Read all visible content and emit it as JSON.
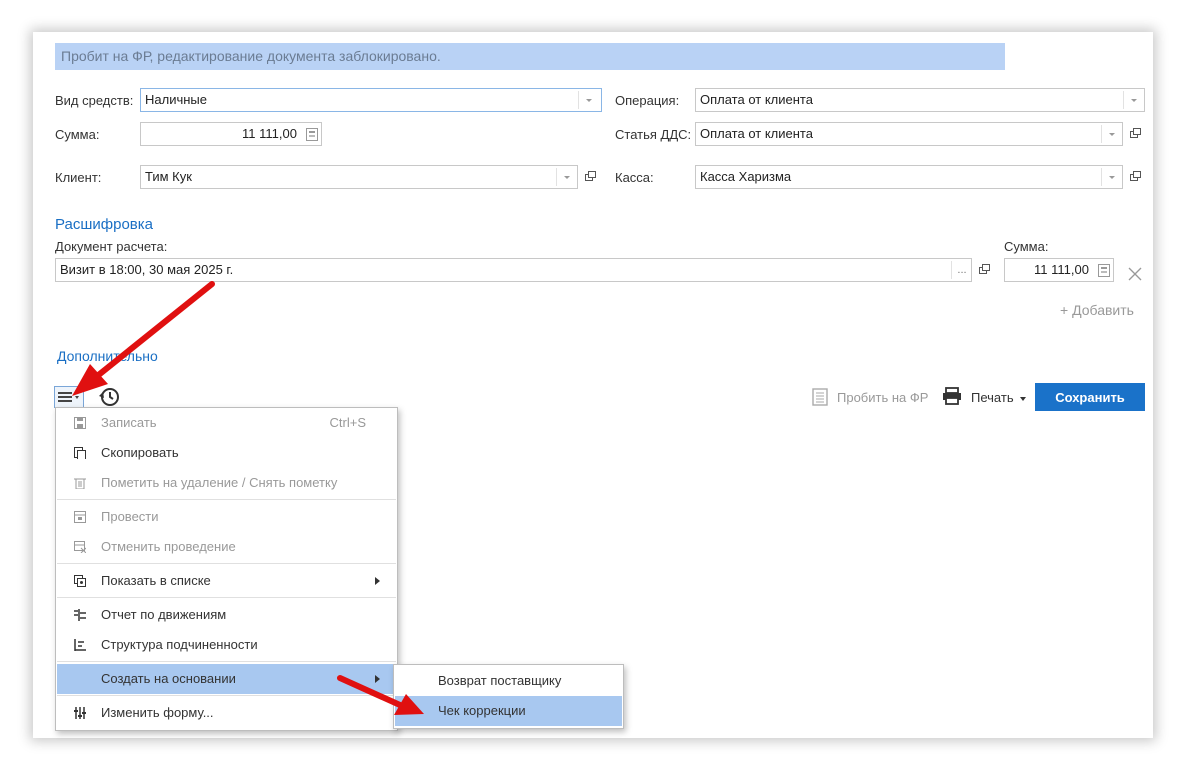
{
  "banner": "Пробит на ФР, редактирование документа заблокировано.",
  "form": {
    "vid_label": "Вид средств:",
    "vid_value": "Наличные",
    "summa_label": "Сумма:",
    "summa_value": "11 111,00",
    "client_label": "Клиент:",
    "client_value": "Тим Кук",
    "operation_label": "Операция:",
    "operation_value": "Оплата от клиента",
    "dds_label": "Статья ДДС:",
    "dds_value": "Оплата от клиента",
    "kassa_label": "Касса:",
    "kassa_value": "Касса Харизма"
  },
  "breakdown": {
    "title": "Расшифровка",
    "doc_label": "Документ расчета:",
    "doc_value": "Визит в 18:00, 30 мая 2025 г.",
    "sum_label": "Сумма:",
    "sum_value": "11 111,00",
    "add_label": "+ Добавить",
    "more_picker": "..."
  },
  "extra_link": "Дополнительно",
  "toolbar": {
    "fr_label": "Пробить на ФР",
    "print_label": "Печать",
    "save_label": "Сохранить"
  },
  "menu": {
    "items": [
      {
        "label": "Записать",
        "shortcut": "Ctrl+S",
        "disabled": true,
        "icon": "save-icon"
      },
      {
        "label": "Скопировать",
        "disabled": false,
        "icon": "copy-icon"
      },
      {
        "label": "Пометить на удаление / Снять пометку",
        "disabled": true,
        "icon": "trash-icon"
      },
      {
        "label": "Провести",
        "disabled": true,
        "icon": "post-icon"
      },
      {
        "label": "Отменить проведение",
        "disabled": true,
        "icon": "unpost-icon"
      },
      {
        "label": "Показать в списке",
        "disabled": false,
        "icon": "list-icon",
        "submenu": true
      },
      {
        "label": "Отчет по движениям",
        "disabled": false,
        "icon": "report-icon"
      },
      {
        "label": "Структура подчиненности",
        "disabled": false,
        "icon": "structure-icon"
      },
      {
        "label": "Создать на основании",
        "disabled": false,
        "icon": "",
        "submenu": true,
        "active": true
      },
      {
        "label": "Изменить форму...",
        "disabled": false,
        "icon": "settings-icon"
      }
    ]
  },
  "submenu": {
    "items": [
      {
        "label": "Возврат поставщику",
        "active": false
      },
      {
        "label": "Чек коррекции",
        "active": true
      }
    ]
  },
  "colors": {
    "accent": "#1a72c9",
    "banner": "#b9d2f5",
    "highlight": "#a8c8f0",
    "arrow": "#e01010"
  }
}
